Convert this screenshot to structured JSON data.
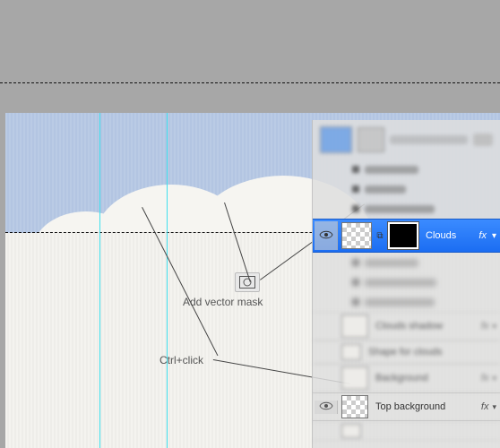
{
  "annotations": {
    "add_vector_mask": "Add vector mask",
    "ctrl_click": "Ctrl+click"
  },
  "layers_panel": {
    "header_doc_hint": "infographic...ph",
    "effects_label": "Effects",
    "effect_stroke": "Stroke",
    "effect_color_overlay": "Color Overlay",
    "effect_inner_shadow": "Inner Shadow",
    "selected_layer": "Clouds",
    "fx_label": "fx",
    "layer_clouds_shadow": "Clouds shadow",
    "layer_shape_for_clouds": "Shape for clouds",
    "layer_background": "Background",
    "layer_top_background": "Top background"
  }
}
